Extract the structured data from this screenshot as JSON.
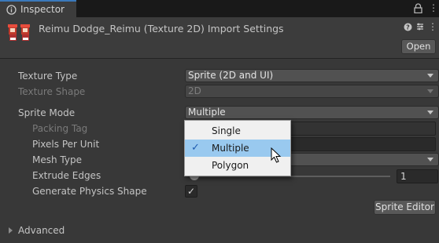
{
  "window": {
    "tab_label": "Inspector",
    "lock_icon": "lock-icon",
    "menu_icon": "kebab-menu-icon"
  },
  "header": {
    "title": "Reimu Dodge_Reimu (Texture 2D) Import Settings",
    "open_button": "Open",
    "help_icon": "help-icon",
    "settings_icon": "preset-settings-icon",
    "more_icon": "more-icon"
  },
  "properties": {
    "texture_type": {
      "label": "Texture Type",
      "value": "Sprite (2D and UI)"
    },
    "texture_shape": {
      "label": "Texture Shape",
      "value": "2D"
    },
    "sprite_mode": {
      "label": "Sprite Mode",
      "value": "Multiple"
    },
    "packing_tag": {
      "label": "Packing Tag",
      "value": ""
    },
    "pixels_per_unit": {
      "label": "Pixels Per Unit",
      "value": ""
    },
    "mesh_type": {
      "label": "Mesh Type",
      "value": ""
    },
    "extrude_edges": {
      "label": "Extrude Edges",
      "value": "1"
    },
    "generate_physics_shape": {
      "label": "Generate Physics Shape",
      "checked": true,
      "check_glyph": "✓"
    }
  },
  "sprite_editor_button": "Sprite Editor",
  "advanced_foldout": "Advanced",
  "sprite_mode_menu": {
    "options": [
      {
        "label": "Single",
        "selected": false
      },
      {
        "label": "Multiple",
        "selected": true
      },
      {
        "label": "Polygon",
        "selected": false
      }
    ],
    "check_glyph": "✓"
  },
  "colors": {
    "background": "#383838",
    "tab_accent": "#3a79bb",
    "menu_highlight": "#99c9ef"
  }
}
